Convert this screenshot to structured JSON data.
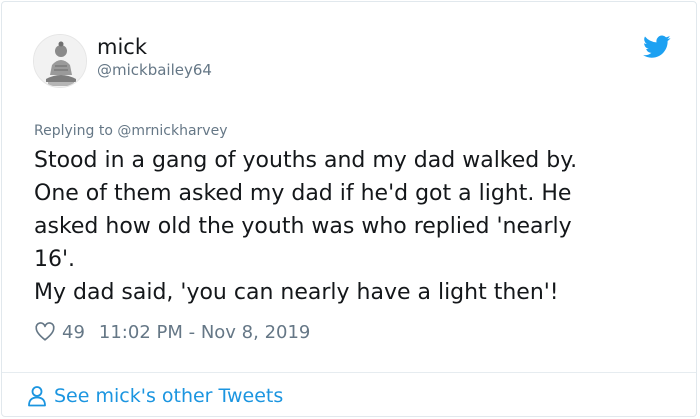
{
  "tweet": {
    "author_name": "mick",
    "author_handle": "@mickbailey64",
    "reply_context": "Replying to @mrnickharvey",
    "lines": [
      "Stood in a gang of youths and my dad walked by.",
      "One of them asked my dad if he'd got a light. He",
      "asked how old the youth was who replied 'nearly",
      "16'.",
      "My dad said, 'you can nearly have a light then'!"
    ],
    "like_count": "49",
    "timestamp": "11:02 PM - Nov 8, 2019"
  },
  "footer": {
    "link_label": "See mick's other Tweets"
  },
  "icons": {
    "brand": "twitter-bird-icon",
    "like": "heart-icon",
    "profile": "person-icon"
  },
  "colors": {
    "brand_blue": "#1da1f2",
    "link_blue": "#1b95e0",
    "secondary_text": "#657786",
    "primary_text": "#14171a"
  }
}
